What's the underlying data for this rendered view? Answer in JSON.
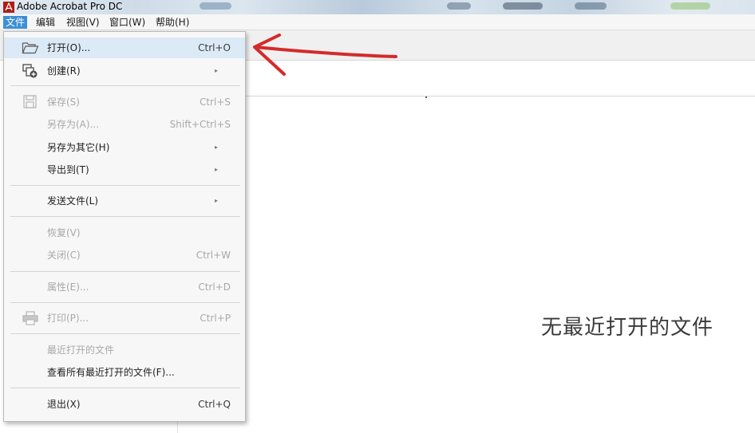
{
  "window": {
    "title": "Adobe Acrobat Pro DC",
    "logo_icon": "acrobat-logo-icon"
  },
  "menubar": {
    "items": [
      {
        "label": "文件",
        "active": true
      },
      {
        "label": "编辑"
      },
      {
        "label": "视图(V)"
      },
      {
        "label": "窗口(W)"
      },
      {
        "label": "帮助(H)"
      }
    ]
  },
  "file_menu": {
    "open": {
      "label": "打开(O)...",
      "shortcut": "Ctrl+O",
      "icon": "folder-open-icon"
    },
    "create": {
      "label": "创建(R)",
      "icon": "create-pdf-icon"
    },
    "save": {
      "label": "保存(S)",
      "shortcut": "Ctrl+S",
      "icon": "save-icon"
    },
    "save_as": {
      "label": "另存为(A)...",
      "shortcut": "Shift+Ctrl+S"
    },
    "save_as_other": {
      "label": "另存为其它(H)"
    },
    "export_to": {
      "label": "导出到(T)"
    },
    "send_file": {
      "label": "发送文件(L)"
    },
    "revert": {
      "label": "恢复(V)"
    },
    "close": {
      "label": "关闭(C)",
      "shortcut": "Ctrl+W"
    },
    "properties": {
      "label": "属性(E)...",
      "shortcut": "Ctrl+D"
    },
    "print": {
      "label": "打印(P)...",
      "shortcut": "Ctrl+P",
      "icon": "printer-icon"
    },
    "recent_header": {
      "label": "最近打开的文件"
    },
    "view_all_recent": {
      "label": "查看所有最近打开的文件(F)..."
    },
    "exit": {
      "label": "退出(X)",
      "shortcut": "Ctrl+Q"
    },
    "submenu_arrow": "▸"
  },
  "main": {
    "empty_recent_text": "无最近打开的文件"
  },
  "colors": {
    "menu_active": "#3d8fd5",
    "menu_highlight": "#dce9f6",
    "annotation_arrow": "#d42a2a"
  }
}
